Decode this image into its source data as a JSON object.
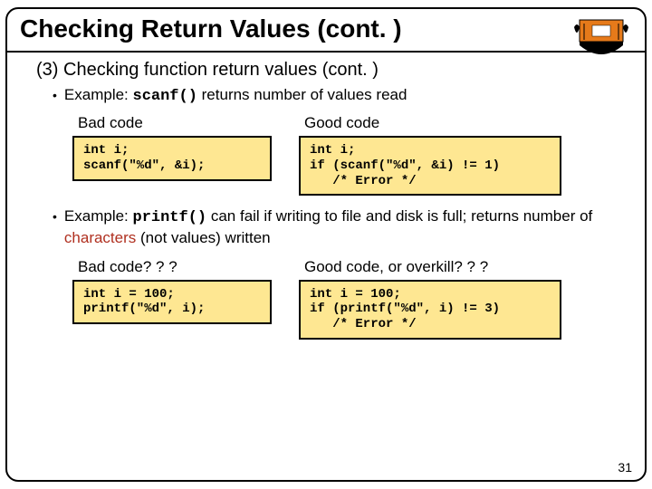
{
  "title": "Checking Return Values (cont. )",
  "section_heading": "(3) Checking function return values (cont. )",
  "example1": {
    "pre": "Example: ",
    "code": "scanf()",
    "post": " returns number of values read",
    "bad_label": "Bad code",
    "good_label": "Good code",
    "bad_code": "int i;\nscanf(\"%d\", &i);",
    "good_code": "int i;\nif (scanf(\"%d\", &i) != 1)\n   /* Error */"
  },
  "example2": {
    "pre": "Example: ",
    "code": "printf()",
    "mid1": " can fail if writing to file and disk is full; returns number of ",
    "red": "characters",
    "mid2": " (not values) written",
    "bad_label": "Bad code? ? ?",
    "good_label": "Good code, or overkill? ? ?",
    "bad_code": "int i = 100;\nprintf(\"%d\", i);",
    "good_code": "int i = 100;\nif (printf(\"%d\", i) != 3)\n   /* Error */"
  },
  "page_number": "31"
}
